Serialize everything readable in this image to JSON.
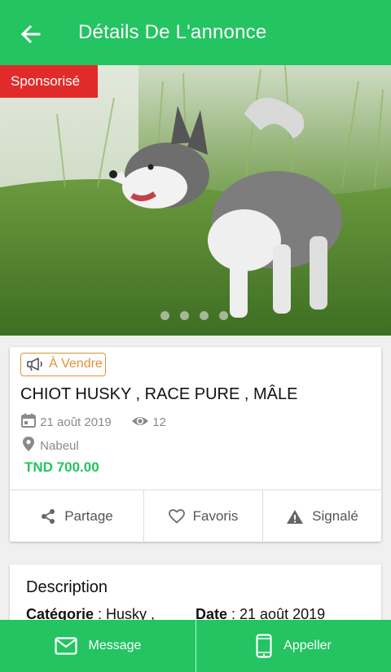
{
  "header": {
    "title": "Détails De L'annonce",
    "back_icon": "arrow-left-icon"
  },
  "listing": {
    "sponsored_label": "Sponsorisé",
    "image_count": 4,
    "badge": "À Vendre",
    "title": "CHIOT HUSKY , RACE PURE , MÂLE",
    "date": "21 août 2019",
    "views": "12",
    "location": "Nabeul",
    "price": "TND 700.00"
  },
  "actions": {
    "share": "Partage",
    "favorites": "Favoris",
    "report": "Signalé"
  },
  "description": {
    "title": "Description",
    "category_label": "Catégorie",
    "category_value": " : Husky ,",
    "date_label": "Date",
    "date_value": " : 21 août 2019"
  },
  "bottom": {
    "message": "Message",
    "call": "Appeller"
  },
  "colors": {
    "primary": "#23c461",
    "sponsor": "#e12b2b",
    "badge": "#e0913a"
  }
}
